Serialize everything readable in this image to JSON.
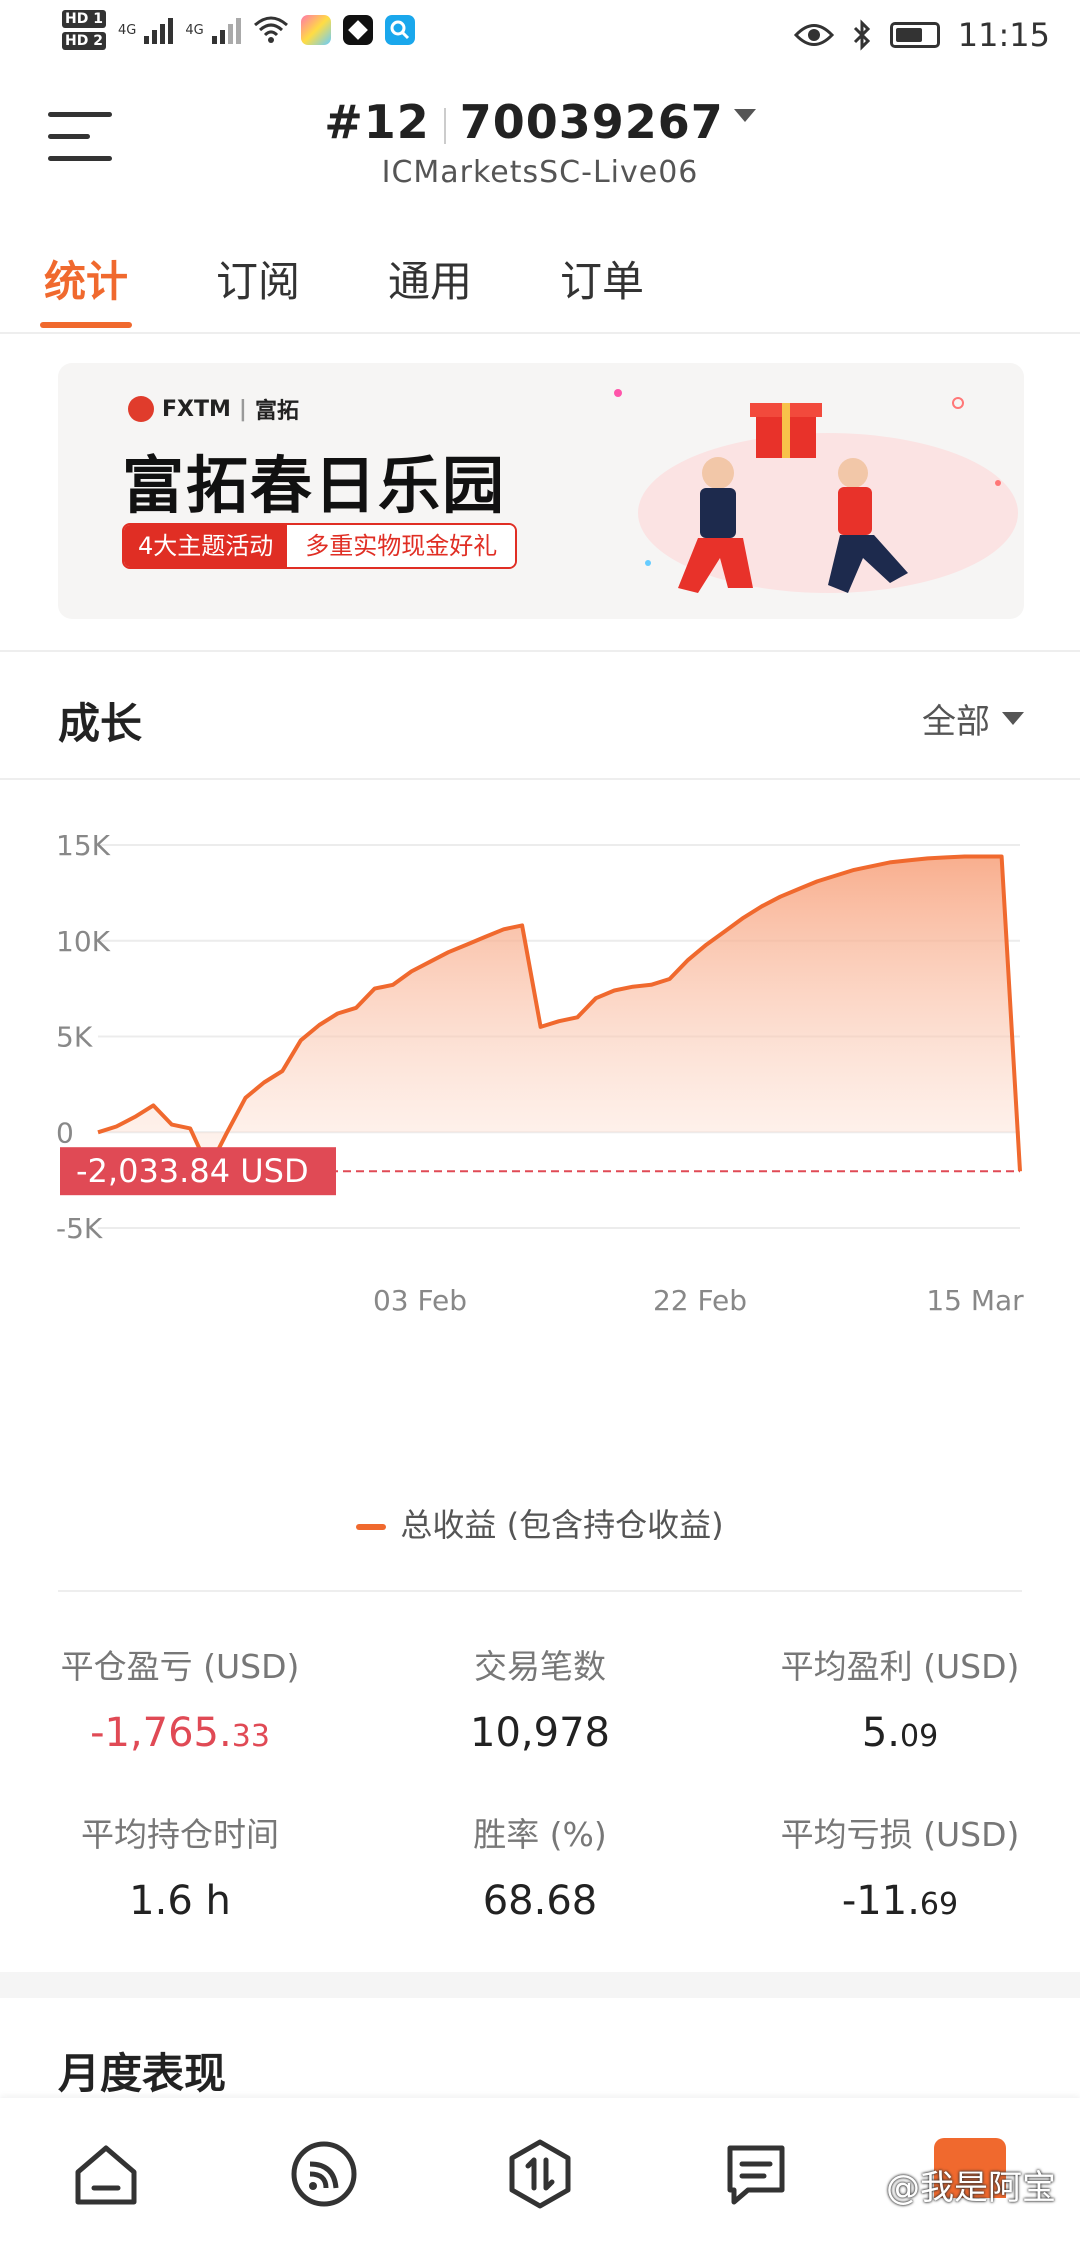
{
  "status_bar": {
    "sim1": "HD 1",
    "sim2": "HD 2",
    "network1": "4G",
    "network2": "4G",
    "time": "11:15",
    "battery_level": 0.7
  },
  "header": {
    "account_prefix": "#12",
    "account_number": "70039267",
    "server": "ICMarketsSC-Live06"
  },
  "tabs": [
    {
      "label": "统计",
      "active": true
    },
    {
      "label": "订阅",
      "active": false
    },
    {
      "label": "通用",
      "active": false
    },
    {
      "label": "订单",
      "active": false
    }
  ],
  "banner": {
    "brand": "FXTM",
    "brand_cn": "富拓",
    "title": "富拓春日乐园",
    "tag_highlight": "4大主题活动",
    "tag_text": "多重实物现金好礼"
  },
  "growth": {
    "title": "成长",
    "filter_label": "全部",
    "legend": "总收益 (包含持仓收益)",
    "current_marker": "-2,033.84 USD"
  },
  "chart_data": {
    "type": "area",
    "series": [
      {
        "name": "总收益 (包含持仓收益)",
        "color": "#f0692e",
        "x": [
          0,
          2,
          4,
          6,
          8,
          10,
          12,
          14,
          16,
          18,
          20,
          22,
          24,
          26,
          28,
          30,
          32,
          34,
          36,
          38,
          40,
          42,
          44,
          46,
          48,
          50,
          52,
          54,
          56,
          58,
          60,
          62,
          64,
          66,
          68,
          70,
          72,
          74,
          76,
          78,
          80,
          82,
          84,
          86,
          88,
          90,
          92,
          94,
          96,
          98,
          100
        ],
        "values": [
          0,
          300,
          800,
          1400,
          400,
          200,
          -1900,
          0,
          1800,
          2600,
          3200,
          4800,
          5600,
          6200,
          6500,
          7500,
          7700,
          8400,
          8900,
          9400,
          9800,
          10200,
          10600,
          10800,
          5500,
          5800,
          6000,
          7000,
          7400,
          7600,
          7700,
          8000,
          9000,
          9800,
          10500,
          11200,
          11800,
          12300,
          12700,
          13100,
          13400,
          13700,
          13900,
          14100,
          14200,
          14300,
          14350,
          14400,
          14400,
          14400,
          -2033.84
        ]
      }
    ],
    "x_tick_labels": [
      "03 Feb",
      "22 Feb",
      "15 Mar"
    ],
    "y_tick_labels": [
      "15K",
      "10K",
      "5K",
      "0",
      "-5K"
    ],
    "ylim": [
      -5000,
      15000
    ],
    "current_value": -2033.84
  },
  "stats": [
    {
      "label": "平仓盈亏 (USD)",
      "int": "-1,765.",
      "dec": "33",
      "negative": true
    },
    {
      "label": "交易笔数",
      "int": "10,978",
      "dec": "",
      "negative": false
    },
    {
      "label": "平均盈利 (USD)",
      "int": "5.",
      "dec": "09",
      "negative": false
    },
    {
      "label": "平均持仓时间",
      "int": "1.6 h",
      "dec": "",
      "negative": false
    },
    {
      "label": "胜率 (%)",
      "int": "68.68",
      "dec": "",
      "negative": false
    },
    {
      "label": "平均亏损 (USD)",
      "int": "-11.",
      "dec": "69",
      "negative": false
    }
  ],
  "monthly": {
    "title": "月度表现"
  },
  "watermark": "@我是阿宝"
}
